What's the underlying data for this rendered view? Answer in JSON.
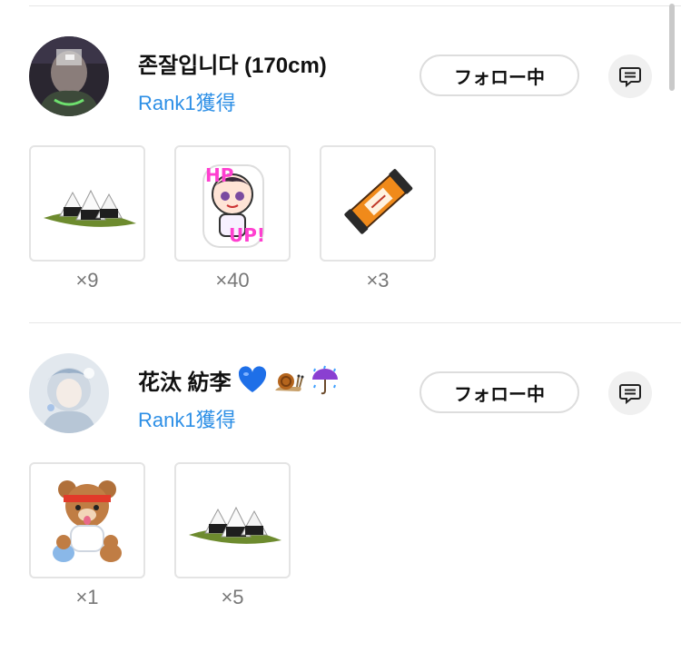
{
  "colors": {
    "rank": "#2d8fe6",
    "count": "#777777",
    "border": "#e4e4e4"
  },
  "users": [
    {
      "name": "존잘입니다 (170cm)",
      "rank": "Rank1獲得",
      "follow_label": "フォロー中",
      "avatar_icon": "dark-photo-avatar",
      "badges": [],
      "gifts": [
        {
          "icon": "rice-balls-on-leaf-icon",
          "count": "×9"
        },
        {
          "icon": "hp-up-sticker-icon",
          "count": "×40"
        },
        {
          "icon": "orange-scroll-icon",
          "count": "×3"
        }
      ]
    },
    {
      "name": "花汰 紡李",
      "rank": "Rank1獲得",
      "follow_label": "フォロー中",
      "avatar_icon": "light-photo-avatar",
      "badges": [
        "blue-heart-icon",
        "snail-icon",
        "umbrella-rain-icon"
      ],
      "gifts": [
        {
          "icon": "teddy-bear-icon",
          "count": "×1"
        },
        {
          "icon": "rice-balls-on-leaf-icon",
          "count": "×5"
        }
      ]
    }
  ]
}
